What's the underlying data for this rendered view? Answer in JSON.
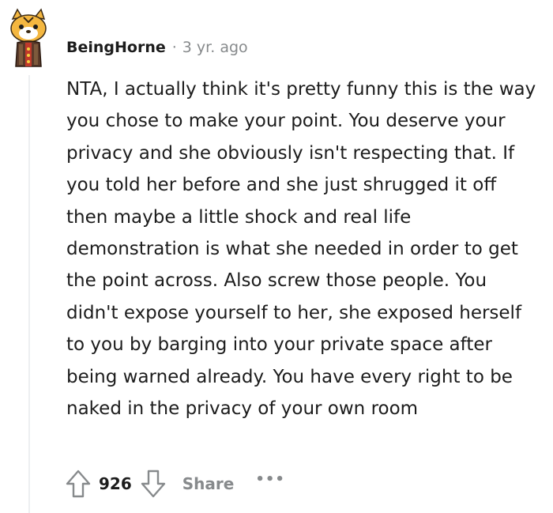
{
  "comment": {
    "author": "BeingHorne",
    "separator": "·",
    "timestamp": "3 yr. ago",
    "body": "NTA, I actually think it's pretty funny this is the way you chose to make your point. You deserve your privacy and she obviously isn't respecting that. If you told her before and she just shrugged it off then maybe a little shock and real life demonstration is what she needed in order to get the point across. Also screw those people. You didn't expose yourself to her, she exposed herself to you by barging into your private space after being warned already. You have every right to be naked in the privacy of your own room",
    "score": "926",
    "share_label": "Share",
    "more_label": "•••"
  },
  "icons": {
    "avatar": "snoo-avatar",
    "upvote": "upvote-arrow-icon",
    "downvote": "downvote-arrow-icon",
    "more": "more-options-icon"
  },
  "colors": {
    "text": "#1c1c1c",
    "meta": "#878a8c",
    "thread_line": "#edeff1",
    "avatar_fur": "#f4b740"
  }
}
